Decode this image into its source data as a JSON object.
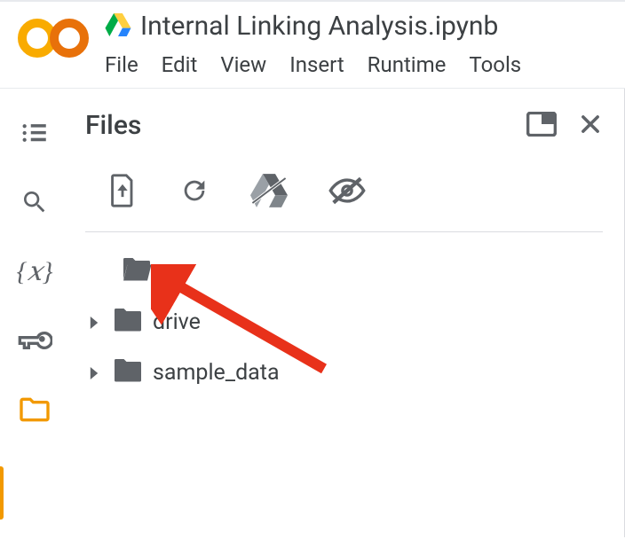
{
  "header": {
    "doc_title": "Internal Linking Analysis.ipynb",
    "menus": [
      "File",
      "Edit",
      "View",
      "Insert",
      "Runtime",
      "Tools"
    ]
  },
  "panel": {
    "title": "Files",
    "tree": {
      "parent_label": "..",
      "items": [
        {
          "label": "drive"
        },
        {
          "label": "sample_data"
        }
      ]
    }
  }
}
